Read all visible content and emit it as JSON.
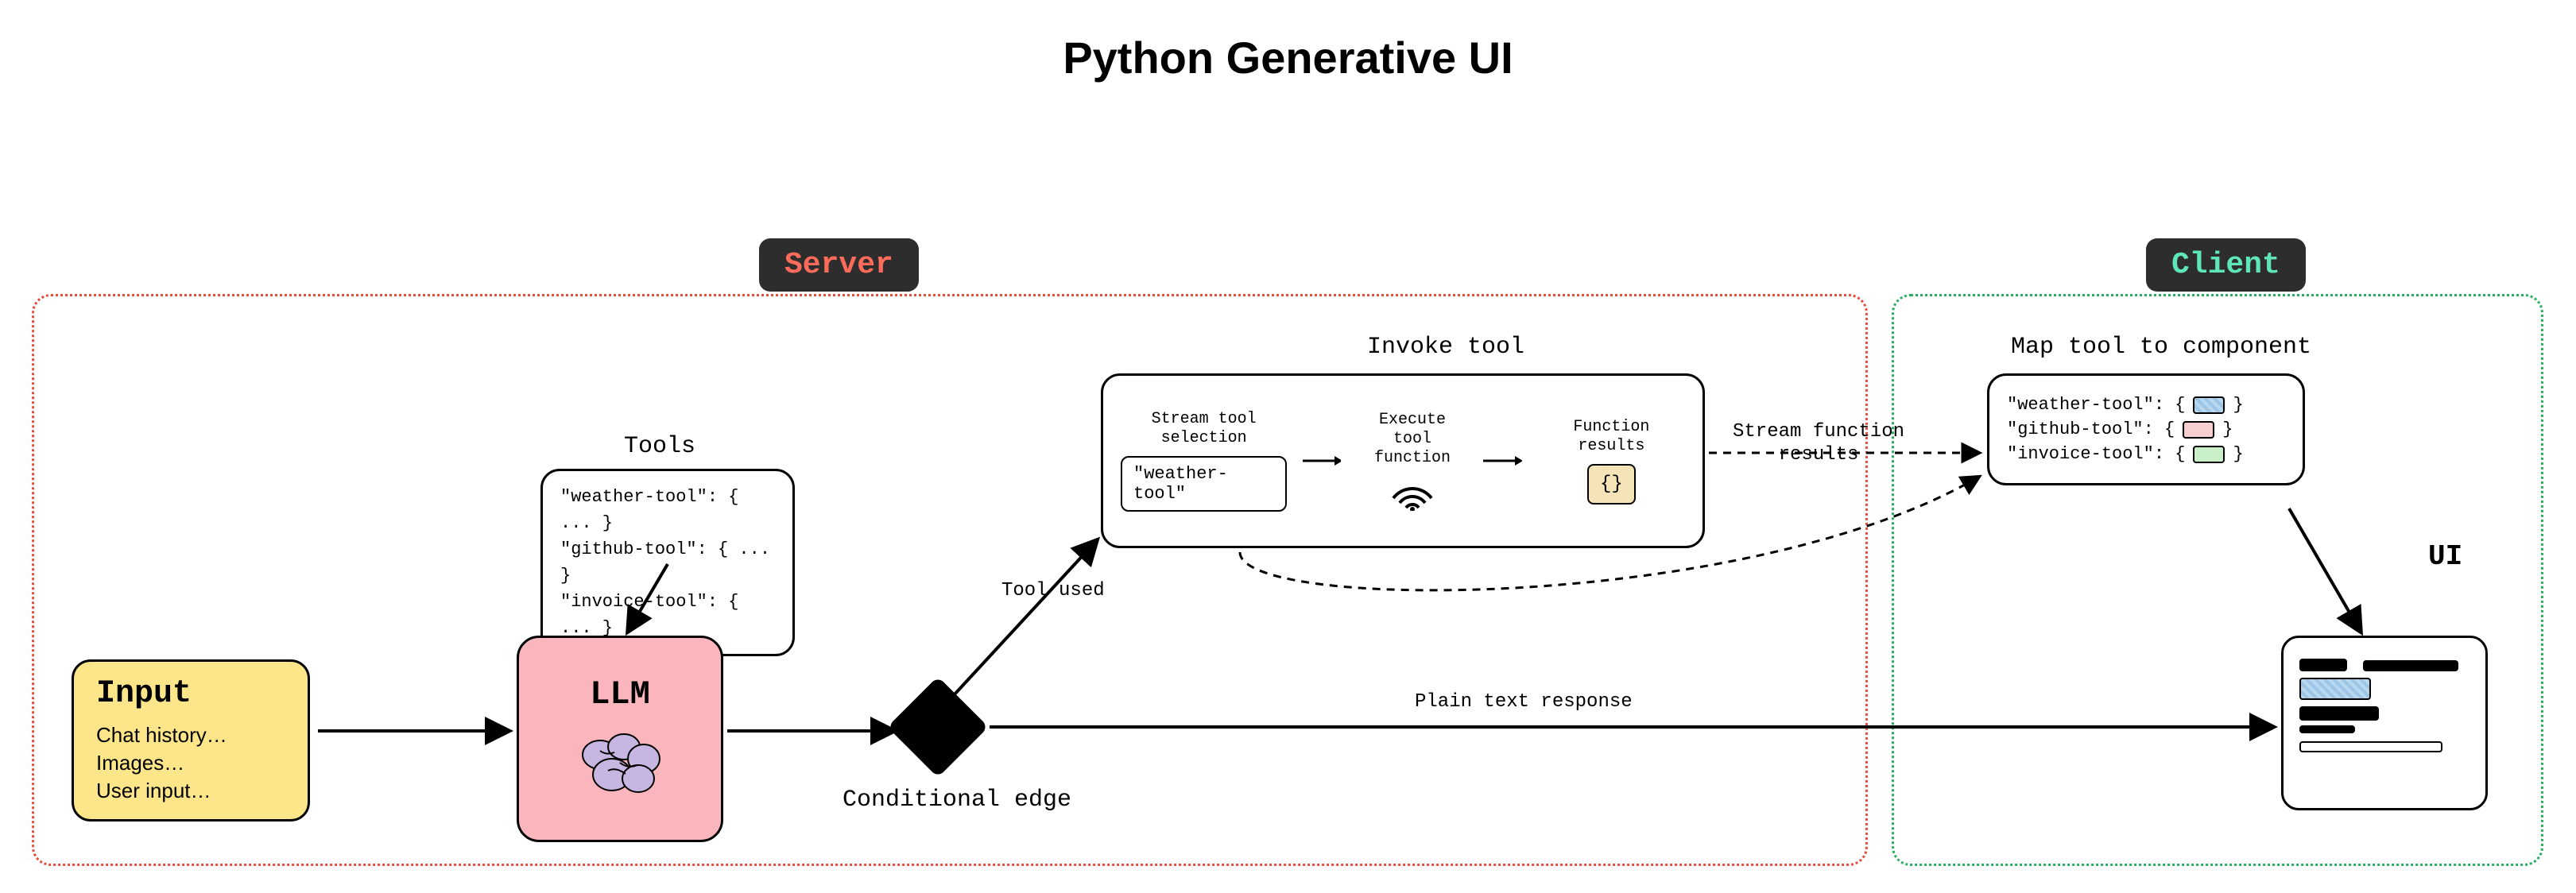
{
  "title": "Python Generative UI",
  "badges": {
    "server": "Server",
    "client": "Client"
  },
  "input": {
    "heading": "Input",
    "lines": [
      "Chat history…",
      "Images…",
      "User input…"
    ]
  },
  "tools": {
    "label": "Tools",
    "entries": [
      "\"weather-tool\": { ... }",
      "\"github-tool\": { ... }",
      "\"invoice-tool\": { ... }"
    ]
  },
  "llm": {
    "heading": "LLM"
  },
  "conditional": {
    "label": "Conditional edge",
    "tool_used": "Tool used",
    "plain_text": "Plain text response"
  },
  "invoke": {
    "label": "Invoke tool",
    "stream_selection": "Stream tool\nselection",
    "selected_tool": "\"weather-tool\"",
    "execute": "Execute tool\nfunction",
    "results": "Function results",
    "result_glyph": "{}"
  },
  "stream_results": "Stream function\nresults",
  "mapping": {
    "label": "Map tool to component",
    "rows": [
      {
        "key": "\"weather-tool\": {",
        "swatch": "blue",
        "close": "}"
      },
      {
        "key": "\"github-tool\": {",
        "swatch": "pink",
        "close": "}"
      },
      {
        "key": "\"invoice-tool\": {",
        "swatch": "green",
        "close": "}"
      }
    ]
  },
  "ui": {
    "label": "UI"
  }
}
